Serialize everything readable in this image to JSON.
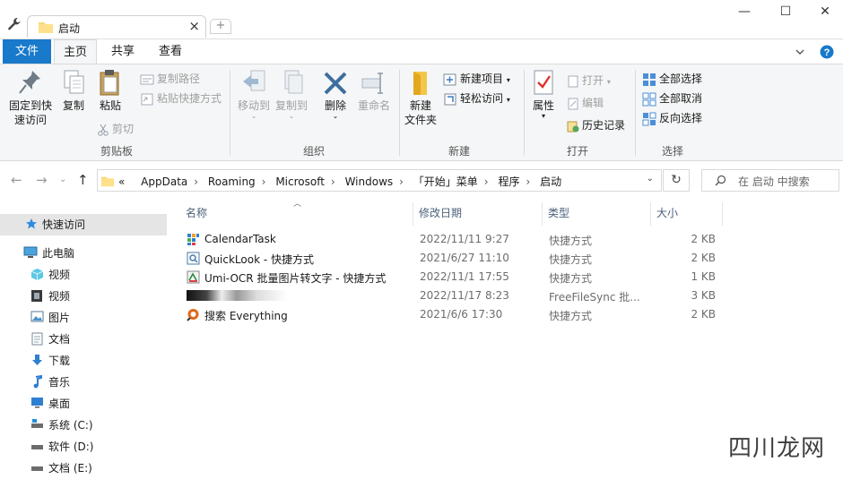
{
  "window": {
    "tab_title": "启动",
    "tab_close": "×",
    "new_tab": "+",
    "minimize": "—",
    "maximize": "☐",
    "close": "✕"
  },
  "ribbon_tabs": {
    "file": "文件",
    "home": "主页",
    "share": "共享",
    "view": "查看"
  },
  "ribbon": {
    "clipboard": {
      "pin_label_1": "固定到快",
      "pin_label_2": "速访问",
      "copy": "复制",
      "paste": "粘贴",
      "copy_path": "复制路径",
      "paste_shortcut": "粘贴快捷方式",
      "cut": "剪切",
      "group": "剪贴板"
    },
    "organize": {
      "move_to": "移动到",
      "copy_to": "复制到",
      "delete": "删除",
      "rename": "重命名",
      "group": "组织"
    },
    "new": {
      "new_folder_1": "新建",
      "new_folder_2": "文件夹",
      "new_item": "新建项目",
      "easy_access": "轻松访问",
      "group": "新建"
    },
    "open": {
      "properties": "属性",
      "open": "打开",
      "edit": "编辑",
      "history": "历史记录",
      "group": "打开"
    },
    "select": {
      "select_all": "全部选择",
      "select_none": "全部取消",
      "invert": "反向选择",
      "group": "选择"
    }
  },
  "address": {
    "prefix": "«",
    "crumbs": [
      "AppData",
      "Roaming",
      "Microsoft",
      "Windows",
      "「开始」菜单",
      "程序",
      "启动"
    ],
    "search_placeholder": "在 启动 中搜索"
  },
  "nav_pane": {
    "items": [
      {
        "label": "快速访问",
        "icon": "star-icon"
      },
      {
        "label": "此电脑",
        "icon": "computer-icon"
      },
      {
        "label": "视频",
        "icon": "cube-icon"
      },
      {
        "label": "视频",
        "icon": "film-icon"
      },
      {
        "label": "图片",
        "icon": "picture-icon"
      },
      {
        "label": "文档",
        "icon": "document-icon"
      },
      {
        "label": "下载",
        "icon": "download-icon"
      },
      {
        "label": "音乐",
        "icon": "music-icon"
      },
      {
        "label": "桌面",
        "icon": "desktop-icon"
      },
      {
        "label": "系统 (C:)",
        "icon": "drive-icon"
      },
      {
        "label": "软件 (D:)",
        "icon": "drive-icon"
      },
      {
        "label": "文档 (E:)",
        "icon": "drive-icon"
      }
    ]
  },
  "columns": {
    "name": "名称",
    "date": "修改日期",
    "type": "类型",
    "size": "大小"
  },
  "files": [
    {
      "name": "CalendarTask",
      "date": "2022/11/11 9:27",
      "type": "快捷方式",
      "size": "2 KB",
      "icon": "calendar-app-icon"
    },
    {
      "name": "QuickLook - 快捷方式",
      "date": "2021/6/27 11:10",
      "type": "快捷方式",
      "size": "2 KB",
      "icon": "quicklook-icon"
    },
    {
      "name": "Umi-OCR 批量图片转文字 - 快捷方式",
      "date": "2022/11/1 17:55",
      "type": "快捷方式",
      "size": "1 KB",
      "icon": "ocr-icon"
    },
    {
      "name": "",
      "date": "2022/11/17 8:23",
      "type": "FreeFileSync 批...",
      "size": "3 KB",
      "icon": "redacted-icon"
    },
    {
      "name": "搜索 Everything",
      "date": "2021/6/6 17:30",
      "type": "快捷方式",
      "size": "2 KB",
      "icon": "everything-icon"
    }
  ],
  "watermark": "四川龙网",
  "colors": {
    "accent": "#1979ca",
    "ribbon_bg": "#f5f6f7",
    "selected_nav": "#e5e5e5",
    "header_text": "#4c607a"
  }
}
